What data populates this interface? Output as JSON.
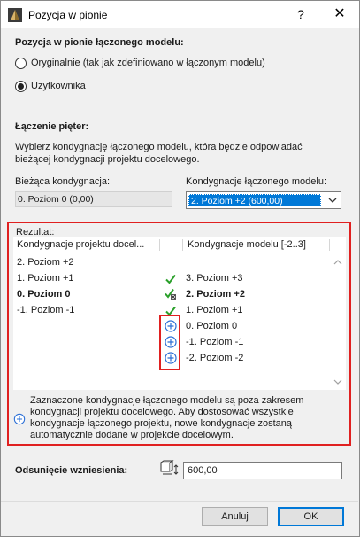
{
  "window": {
    "title": "Pozycja w pionie",
    "help_label": "?",
    "close_label": "✕"
  },
  "position": {
    "section_title": "Pozycja w pionie łączonego modelu:",
    "options": [
      {
        "label": "Oryginalnie (tak jak zdefiniowano w łączonym modelu)",
        "checked": false
      },
      {
        "label": "Użytkownika",
        "checked": true
      }
    ]
  },
  "linking": {
    "section_title": "Łączenie pięter:",
    "description_line1": "Wybierz kondygnację łączonego modelu, która będzie odpowiadać",
    "description_line2": "bieżącej kondygnacji projektu docelowego.",
    "current_label": "Bieżąca kondygnacja:",
    "current_value": "0. Poziom 0 (0,00)",
    "linked_label": "Kondygnacje łączonego modelu:",
    "linked_value": "2. Poziom +2 (600,00)"
  },
  "result": {
    "title": "Rezultat:",
    "col_left": "Kondygnacje projektu docel...",
    "col_right": "Kondygnacje modelu [-2..3]",
    "rows": [
      {
        "left": "2. Poziom +2",
        "mark": "",
        "right": "",
        "bold": false
      },
      {
        "left": "1. Poziom +1",
        "mark": "check",
        "right": "3. Poziom +3",
        "bold": false
      },
      {
        "left": "0. Poziom 0",
        "mark": "check-link",
        "right": "2. Poziom +2",
        "bold": true
      },
      {
        "left": "-1. Poziom -1",
        "mark": "check",
        "right": "1. Poziom +1",
        "bold": false
      },
      {
        "left": "",
        "mark": "plus",
        "right": "0. Poziom 0",
        "bold": false
      },
      {
        "left": "",
        "mark": "plus",
        "right": "-1. Poziom -1",
        "bold": false
      },
      {
        "left": "",
        "mark": "plus",
        "right": "-2. Poziom -2",
        "bold": false
      }
    ],
    "info_line1": "Zaznaczone kondygnacje łączonego modelu są poza zakresem",
    "info_line2": "kondygnacji projektu docelowego. Aby dostosować wszystkie",
    "info_line3": "kondygnacje łączonego projektu, nowe kondygnacje zostaną",
    "info_line4": "automatycznie dodane w projekcie docelowym."
  },
  "elevation": {
    "label": "Odsunięcie wzniesienia:",
    "value": "600,00"
  },
  "buttons": {
    "cancel": "Anuluj",
    "ok": "OK"
  },
  "colors": {
    "highlight_border": "#e02020",
    "check": "#2aa02a",
    "plus": "#2b6fd6",
    "selection": "#0078d7"
  }
}
